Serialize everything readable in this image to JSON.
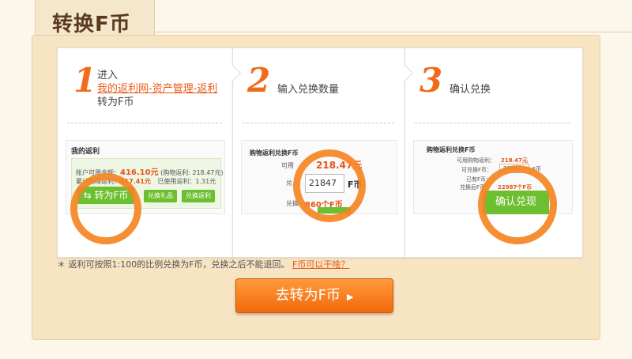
{
  "header": {
    "title": "转换F币"
  },
  "steps": [
    {
      "number": "1",
      "line1": "进入",
      "link": "我的返利网-资产管理-返利",
      "line2": "转为F币"
    },
    {
      "number": "2",
      "text": "输入兑换数量"
    },
    {
      "number": "3",
      "text": "确认兑换"
    }
  ],
  "step1_preview": {
    "title": "我的返利",
    "row1_label": "账户可用余额：",
    "row1_value": "416.10元",
    "row1_note": "(购物返利: 218.47元)",
    "row2_label": "累计获得返利：",
    "row2_value": "417.41元",
    "row2_label_b": "已使用返利：",
    "row2_value_b": "1.31元",
    "button": "转为F币",
    "btn_gift": "兑换礼品",
    "btn_rebate": "兑换返利"
  },
  "step2_preview": {
    "title": "购物返利兑换F币",
    "available_label": "可用",
    "available_value": "218.47元",
    "exchange_label": "兑",
    "input_value": "21847",
    "unit": "F币",
    "result_label": "兑换",
    "result_value": "860个F币"
  },
  "step3_preview": {
    "title": "购物返利兑换F币",
    "r1_label": "可用购物返利：",
    "r1_value": "218.47元",
    "r2_label": "可兑换F币：",
    "r2_value": "21847",
    "r2_unit": "F币",
    "r3_label": "已有F币：",
    "r4_label": "兑换后F币：",
    "r4_value": "22987个F币",
    "button": "确认兑现"
  },
  "note": {
    "text": "＊ 返利可按照1:100的比例兑换为F币，兑换之后不能退回。",
    "link": "F币可以干啥？"
  },
  "cta": {
    "label": "去转为F币",
    "arrow": "▶"
  }
}
